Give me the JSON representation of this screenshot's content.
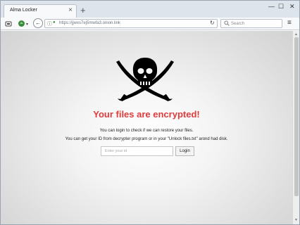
{
  "browser": {
    "tab_title": "Alma Locker",
    "tab_close": "×",
    "new_tab": "+",
    "window_minimize": "—",
    "window_maximize": "☐",
    "window_close": "✕",
    "url": "https://jjwxs7ej5mwfa3.onion.link",
    "search_placeholder": "Search",
    "icons": {
      "tab_close": "close-icon",
      "new_tab": "plus-icon",
      "back": "back-arrow-icon",
      "reload": "reload-icon",
      "search": "search-icon",
      "menu": "hamburger-menu-icon"
    }
  },
  "page": {
    "headline": "Your files are encrypted!",
    "line1": "You can login to check if we can restore your files.",
    "line2": "You can get your ID from decrypter program or in your \"Unlock files.txt\" arond had disk.",
    "id_placeholder": "Enter your id",
    "login_label": "Login",
    "colors": {
      "headline": "#e03b3b",
      "emblem": "#000000"
    }
  }
}
